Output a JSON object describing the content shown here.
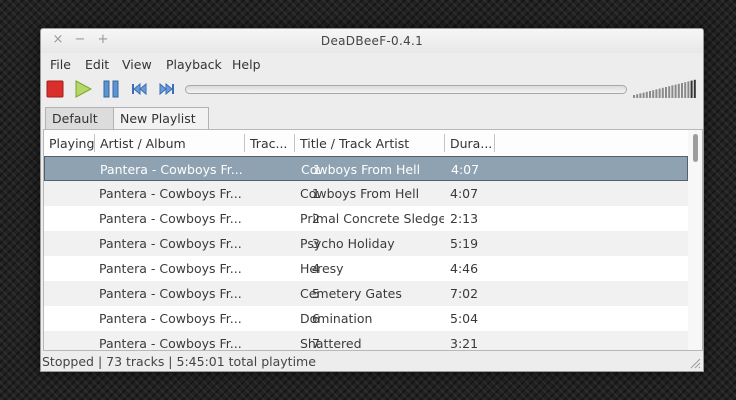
{
  "window": {
    "title": "DeaDBeeF-0.4.1"
  },
  "titlebar_buttons": {
    "close": "×",
    "minimize": "−",
    "maximize": "+"
  },
  "menu": [
    "File",
    "Edit",
    "View",
    "Playback",
    "Help"
  ],
  "toolbar": {
    "buttons": [
      "stop-icon",
      "play-icon",
      "pause-icon",
      "prev-icon",
      "next-icon"
    ],
    "colors": {
      "stop": "#d9302c",
      "play": "#a7d13f",
      "pause": "#4a86c8",
      "nav": "#3a6fb5"
    }
  },
  "tabs": [
    {
      "label": "Default",
      "active": false
    },
    {
      "label": "New Playlist",
      "active": true
    }
  ],
  "columns": [
    "Playing",
    "Artist / Album",
    "Trac...",
    "Title / Track Artist",
    "Dura..."
  ],
  "rows": [
    {
      "artist": "Pantera - Cowboys Fr...",
      "track": "1",
      "title": "Cowboys From Hell",
      "duration": "4:07",
      "selected": true
    },
    {
      "artist": "Pantera - Cowboys Fr...",
      "track": "1",
      "title": "Cowboys From Hell",
      "duration": "4:07"
    },
    {
      "artist": "Pantera - Cowboys Fr...",
      "track": "2",
      "title": "Primal Concrete Sledge",
      "duration": "2:13"
    },
    {
      "artist": "Pantera - Cowboys Fr...",
      "track": "3",
      "title": "Psycho Holiday",
      "duration": "5:19"
    },
    {
      "artist": "Pantera - Cowboys Fr...",
      "track": "4",
      "title": "Heresy",
      "duration": "4:46"
    },
    {
      "artist": "Pantera - Cowboys Fr...",
      "track": "5",
      "title": "Cemetery Gates",
      "duration": "7:02"
    },
    {
      "artist": "Pantera - Cowboys Fr...",
      "track": "6",
      "title": "Domination",
      "duration": "5:04"
    },
    {
      "artist": "Pantera - Cowboys Fr...",
      "track": "7",
      "title": "Shattered",
      "duration": "3:21"
    }
  ],
  "status": "Stopped | 73 tracks | 5:45:01 total playtime",
  "volume_level": 1.0
}
